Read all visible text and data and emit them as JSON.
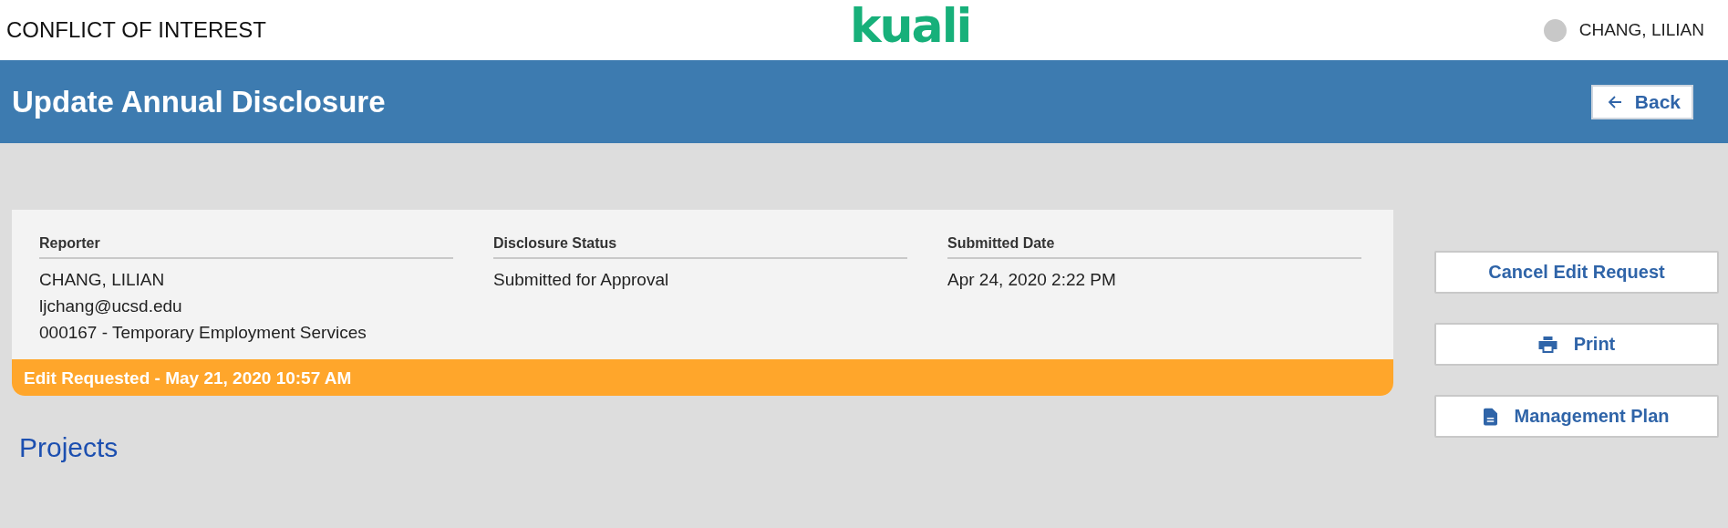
{
  "header": {
    "app_title": "CONFLICT OF INTEREST",
    "logo": "kuali",
    "user_name": "CHANG, LILIAN"
  },
  "title_bar": {
    "title": "Update Annual Disclosure",
    "back_button": "Back"
  },
  "summary": {
    "fields": [
      {
        "label": "Reporter",
        "lines": [
          "CHANG, LILIAN",
          "ljchang@ucsd.edu",
          "000167 - Temporary Employment Services"
        ]
      },
      {
        "label": "Disclosure Status",
        "lines": [
          "Submitted for Approval"
        ]
      },
      {
        "label": "Submitted Date",
        "lines": [
          "Apr 24, 2020 2:22 PM"
        ]
      }
    ],
    "banner": "Edit Requested - May 21, 2020 10:57 AM"
  },
  "actions": [
    {
      "label": "Cancel Edit Request",
      "kind": "plain"
    },
    {
      "label": "Print",
      "kind": "print"
    },
    {
      "label": "Management Plan",
      "kind": "document"
    }
  ],
  "section_heading": "Projects"
}
